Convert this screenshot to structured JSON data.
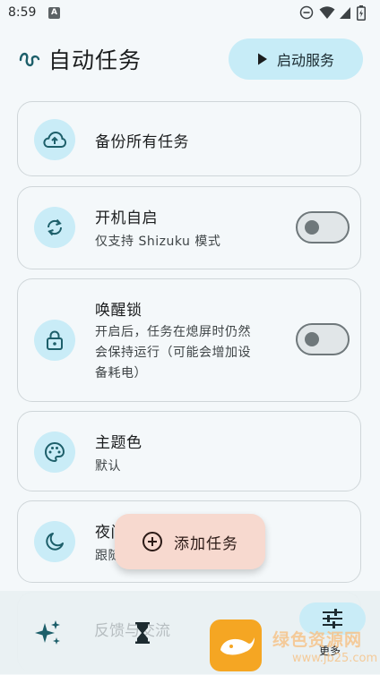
{
  "status_bar": {
    "time": "8:59",
    "a_badge": "A"
  },
  "header": {
    "title": "自动任务",
    "start_button_label": "启动服务"
  },
  "cards": {
    "backup": {
      "title": "备份所有任务"
    },
    "autostart": {
      "title": "开机自启",
      "subtitle": "仅支持 Shizuku 模式",
      "toggle_on": false
    },
    "wakelock": {
      "title": "唤醒锁",
      "subtitle": [
        "开启后，任务在熄屏时仍然",
        "会保持运行（可能会增加设",
        "备耗电）"
      ],
      "toggle_on": false
    },
    "theme": {
      "title": "主题色",
      "subtitle": "默认"
    },
    "night": {
      "title": "夜间模式",
      "subtitle": "跟随系统"
    },
    "feedback": {
      "title": "反馈与交流"
    }
  },
  "fab": {
    "label": "添加任务"
  },
  "bottom_nav": {
    "more_label": "更多"
  },
  "watermark": {
    "text": "绿色资源网",
    "url": "www.jb25.com"
  },
  "colors": {
    "accent_light": "#c9ecf7",
    "fab_bg": "#f7d9cf",
    "icon_dark": "#1d5f6a"
  }
}
